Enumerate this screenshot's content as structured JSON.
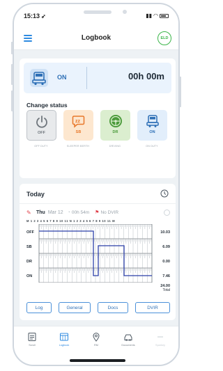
{
  "status_bar": {
    "time": "15:13",
    "location_icon": "location-arrow-icon",
    "signal_icon": "signal-icon",
    "wifi_icon": "wifi-icon",
    "battery_icon": "battery-icon"
  },
  "nav": {
    "title": "Logbook",
    "menu_icon": "hamburger-menu-icon",
    "eld_badge": "ELD"
  },
  "current_status": {
    "status": "ON",
    "duration": "00h 00m",
    "icon": "truck-icon"
  },
  "change_status": {
    "title": "Change status",
    "options": [
      {
        "label": "OFF",
        "caption": "OFF DUTY",
        "icon": "power-icon",
        "color": "#6f767d"
      },
      {
        "label": "SB",
        "caption": "SLEEPER BERTH",
        "icon": "sleep-zz-icon",
        "color": "#e8782a"
      },
      {
        "label": "DR",
        "caption": "DRIVING",
        "icon": "steering-wheel-icon",
        "color": "#4a9a3a"
      },
      {
        "label": "ON",
        "caption": "ON DUTY",
        "icon": "truck-icon",
        "color": "#2d6fb6"
      }
    ]
  },
  "today": {
    "title": "Today",
    "clock_icon": "clock-icon",
    "day": "Thu",
    "date": "Mar 12",
    "duration": "00h 54m",
    "dvir": "No DVIR",
    "hour_ruler": "M 1 2 3 4 5 6 7 8 9 10 11 N 1 2 3 4 5 6 7 8 9 10 11 M",
    "rows": [
      {
        "label": "OFF",
        "total": "10.03"
      },
      {
        "label": "SB",
        "total": "6.09"
      },
      {
        "label": "DR",
        "total": "0.00"
      },
      {
        "label": "ON",
        "total": "7.46"
      }
    ],
    "grand_total": "24.00",
    "grand_total_label": "Total"
  },
  "actions": [
    "Log",
    "General",
    "Docs",
    "DVIR"
  ],
  "tabs": [
    {
      "label": "Scroll",
      "icon": "scroll-icon",
      "active": false
    },
    {
      "label": "Logbook",
      "icon": "logbook-icon",
      "active": true
    },
    {
      "label": "RM",
      "icon": "map-pin-icon",
      "active": false
    },
    {
      "label": "Documents",
      "icon": "documents-icon",
      "active": false
    },
    {
      "label": "Sparkey",
      "icon": "more-icon",
      "active": false
    }
  ],
  "colors": {
    "accent": "#2d8ae0",
    "eld_green": "#3bb54a",
    "grid_line": "#2b3ea8"
  }
}
